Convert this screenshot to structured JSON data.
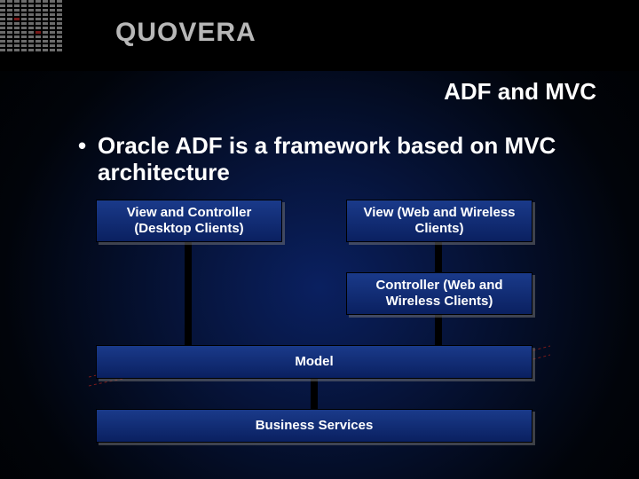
{
  "logo": "QUOVERA",
  "title": "ADF and MVC",
  "bullet_text": "Oracle ADF is a framework based on MVC architecture",
  "diagram": {
    "view_desktop": "View and Controller (Desktop Clients)",
    "view_web": "View (Web and Wireless Clients)",
    "controller_web": "Controller (Web and Wireless Clients)",
    "model": "Model",
    "business_services": "Business Services"
  }
}
